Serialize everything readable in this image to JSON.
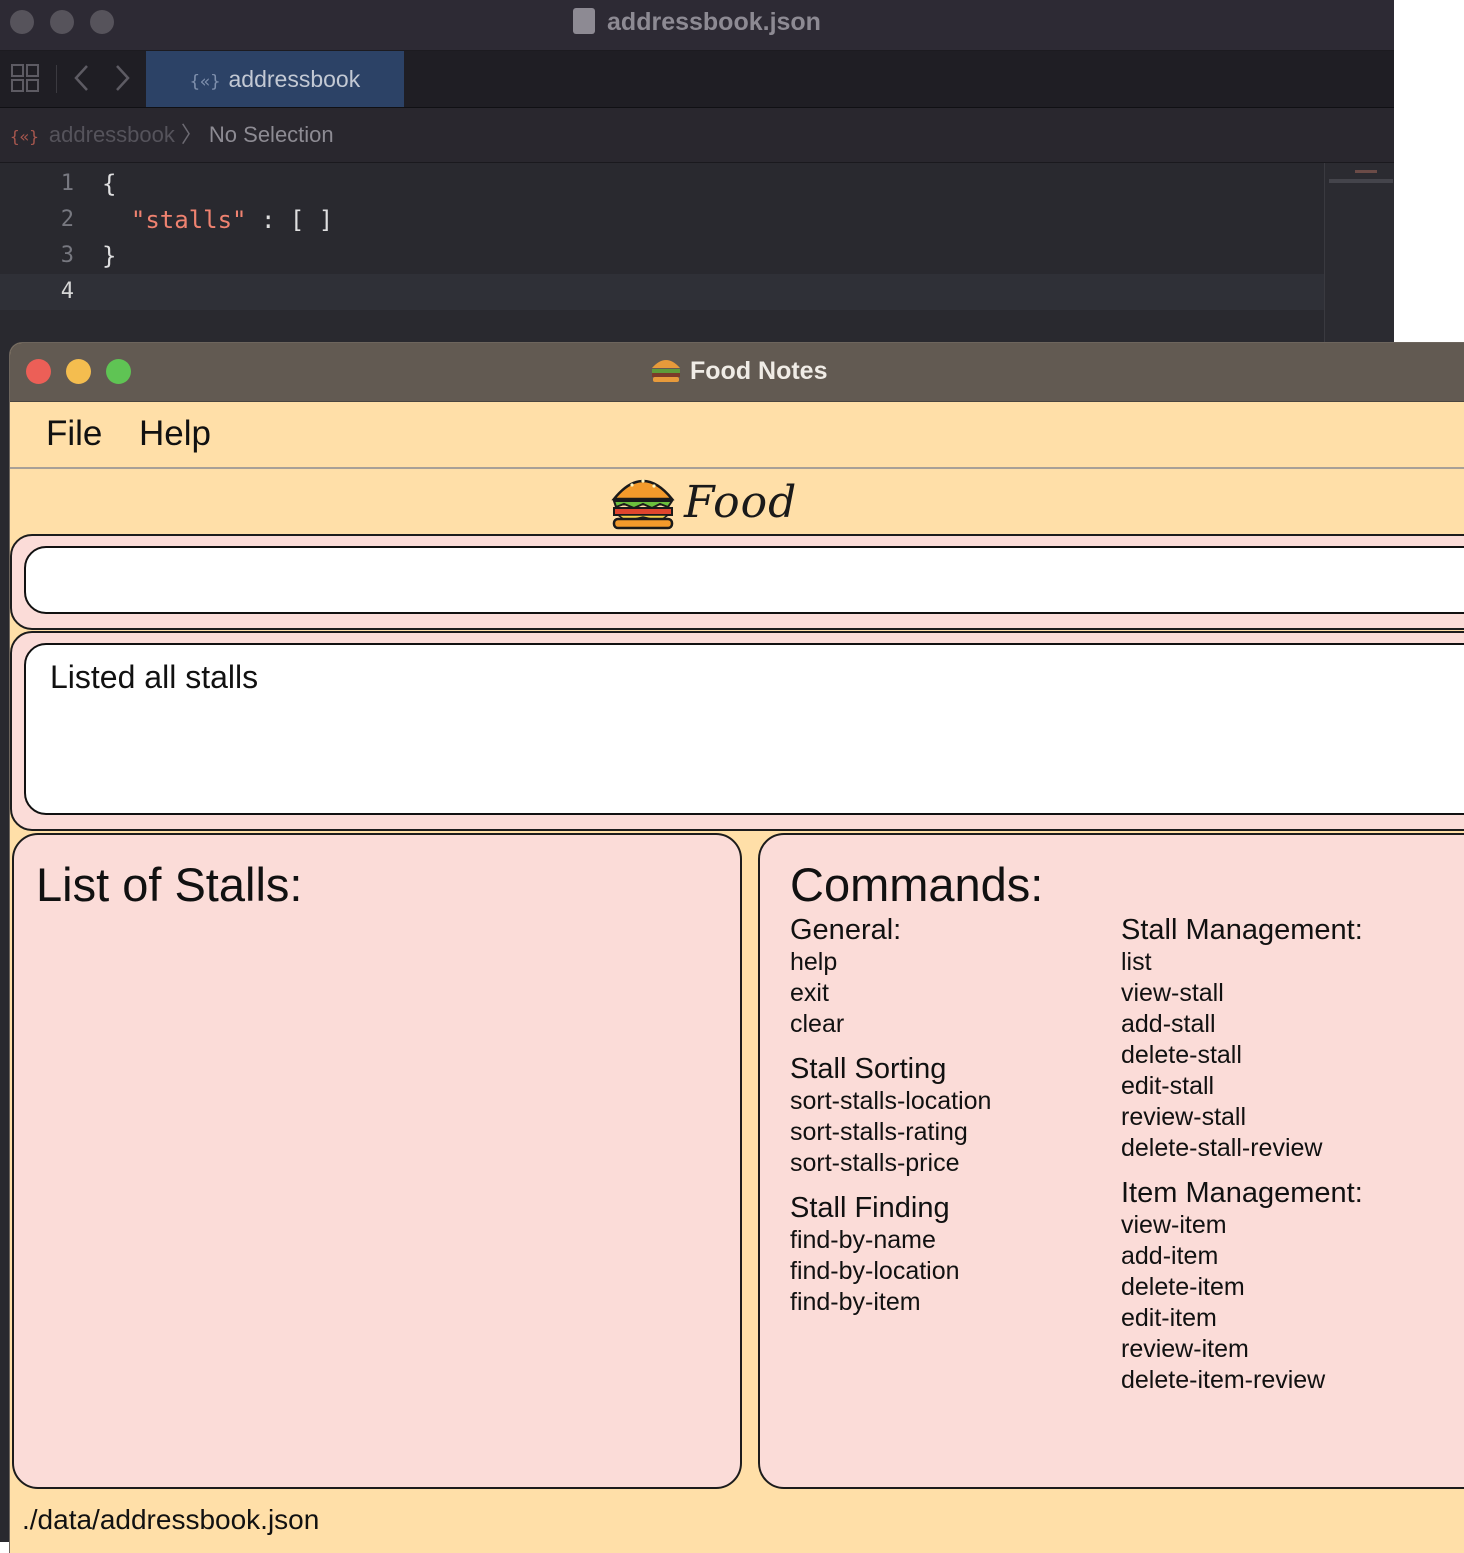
{
  "xcode": {
    "window_title": "addressbook.json",
    "tab_label": "addressbook",
    "tab_icon": "{«}",
    "jumpbar": {
      "icon": "{«}",
      "file": "addressbook",
      "selection": "No Selection"
    },
    "code_lines": [
      {
        "num": "1",
        "text": "{"
      },
      {
        "num": "2",
        "indent": "  ",
        "key": "\"stalls\"",
        "rest": " : [ ]"
      },
      {
        "num": "3",
        "text": "}"
      },
      {
        "num": "4",
        "text": ""
      }
    ]
  },
  "app": {
    "window_title": "Food Notes",
    "menu": [
      "File",
      "Help"
    ],
    "brand": "Food Notes",
    "command_input": {
      "value": "",
      "placeholder": ""
    },
    "result_text": "Listed all stalls",
    "stalls_title": "List of Stalls:",
    "commands_title": "Commands:",
    "commands": {
      "left": [
        {
          "heading": "General:",
          "items": [
            "help",
            "exit",
            "clear"
          ]
        },
        {
          "heading": "Stall Sorting",
          "items": [
            "sort-stalls-location",
            "sort-stalls-rating",
            "sort-stalls-price"
          ]
        },
        {
          "heading": "Stall Finding",
          "items": [
            "find-by-name",
            "find-by-location",
            "find-by-item"
          ]
        }
      ],
      "right": [
        {
          "heading": "Stall Management:",
          "items": [
            "list",
            "view-stall",
            "add-stall",
            "delete-stall",
            "edit-stall",
            "review-stall",
            "delete-stall-review"
          ]
        },
        {
          "heading": "Item Management:",
          "items": [
            "view-item",
            "add-item",
            "delete-item",
            "edit-item",
            "review-item",
            "delete-item-review"
          ]
        }
      ]
    },
    "status_path": "./data/addressbook.json"
  },
  "colors": {
    "app_background": "#ffdfa8",
    "panel_pink": "#fbdcd8",
    "close": "#ec5f57",
    "minimize": "#f4bd4f",
    "zoom": "#5fc454",
    "xcode_tab_active": "#2c4266",
    "json_string": "#ef8270"
  },
  "icons": [
    "grid-icon",
    "back-chevron-icon",
    "forward-chevron-icon",
    "json-brace-icon",
    "document-icon",
    "burger-icon"
  ]
}
